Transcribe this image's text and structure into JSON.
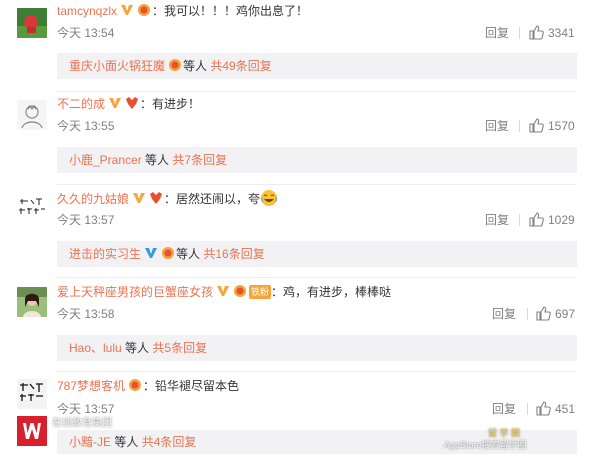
{
  "comments": [
    {
      "username": "tamcynqzlx",
      "text": "：我可以！！！鸡你出息了！",
      "time": "今天 13:54",
      "reply": "回复",
      "likes": "3341",
      "sub": {
        "user": "重庆小面火锅狂魔",
        "deng": "等人",
        "count": "共49条回复"
      }
    },
    {
      "username": "不二的成",
      "text": "：有进步！",
      "time": "今天 13:55",
      "reply": "回复",
      "likes": "1570",
      "sub": {
        "user": "小鹿_Prancer",
        "deng": "等人",
        "count": "共7条回复"
      }
    },
    {
      "username": "久久的九姑娘",
      "text": "：居然还闹以，夸",
      "time": "今天 13:57",
      "reply": "回复",
      "likes": "1029",
      "avatar_text": "久久 的九姑娘",
      "sub": {
        "user": "进击的实习生",
        "deng": "等人",
        "count": "共16条回复"
      }
    },
    {
      "username": "爱上天秤座男孩的巨蟹座女孩",
      "fan_badge": "铁粉",
      "text": "：鸡，有进步，棒棒哒",
      "time": "今天 13:58",
      "reply": "回复",
      "likes": "697",
      "sub": {
        "user": "Hao、lulu",
        "deng": "等人",
        "count": "共5条回复"
      }
    },
    {
      "username": "787梦想客机",
      "text": "：铅华褪尽留本色",
      "time": "今天 13:57",
      "reply": "回复",
      "likes": "451",
      "sub": {
        "user": "小黯-JE",
        "deng": "等人",
        "count": "共4条回复"
      }
    }
  ],
  "watermark": {
    "left_text": "在线教育集团",
    "right_top": "留 学 圈",
    "right_bottom": "AppStore搜索留学圈"
  },
  "colors": {
    "username": "#eb7350",
    "meta": "#808080",
    "subbox_bg": "#f2f2f5",
    "vip_badge": "#f7a43a",
    "blue_v": "#3a9bd9"
  },
  "icons": [
    "vip-v-icon",
    "medal-icon",
    "thumb-up-icon",
    "laugh-emoji-icon"
  ]
}
